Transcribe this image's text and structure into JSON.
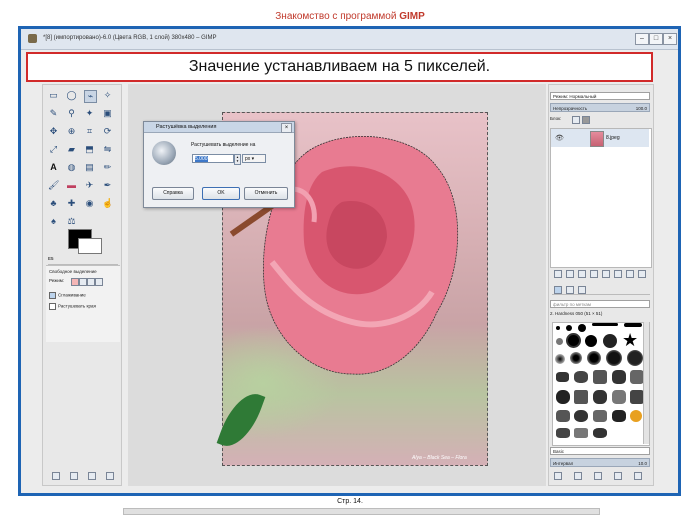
{
  "page_title": {
    "prefix": "Знакомство с программой ",
    "bold": "GIMP"
  },
  "window": {
    "title": "*[8] (импортировано)-6.0 (Цвета RGB, 1 слой) 380x480 – GIMP",
    "minimize": "–",
    "maximize": "□",
    "close": "×"
  },
  "banner": {
    "text": "Значение устанавливаем на 5 пикселей."
  },
  "toolbox": {
    "tab_label": "Свободное выделение",
    "mode_label": "Режим:",
    "antialias": "Сглаживание",
    "feather": "Растушевать края",
    "tab_number": "E5"
  },
  "dialog": {
    "title": "Растушёвка выделения",
    "close": "×",
    "label": "Растушевать выделение на",
    "value": "5.000",
    "unit": "px ▾",
    "help": "Справка",
    "ok": "OK",
    "cancel": "Отменить"
  },
  "layers": {
    "mode_label": "Режим: Нормальный",
    "opacity_label": "Непрозрачность",
    "opacity_value": "100.0",
    "lock_label": "Блок:",
    "layer_name": "8.jpeg"
  },
  "brushes": {
    "filter_placeholder": "фильтр по меткам",
    "current": "2. Hardness 050 (51 × 51)",
    "preset": "Basic",
    "spacing_label": "Интервал",
    "spacing_value": "10.0"
  },
  "watermark": "Alya – Black Sea – Flora",
  "footer": {
    "page": "Стр. 14."
  }
}
